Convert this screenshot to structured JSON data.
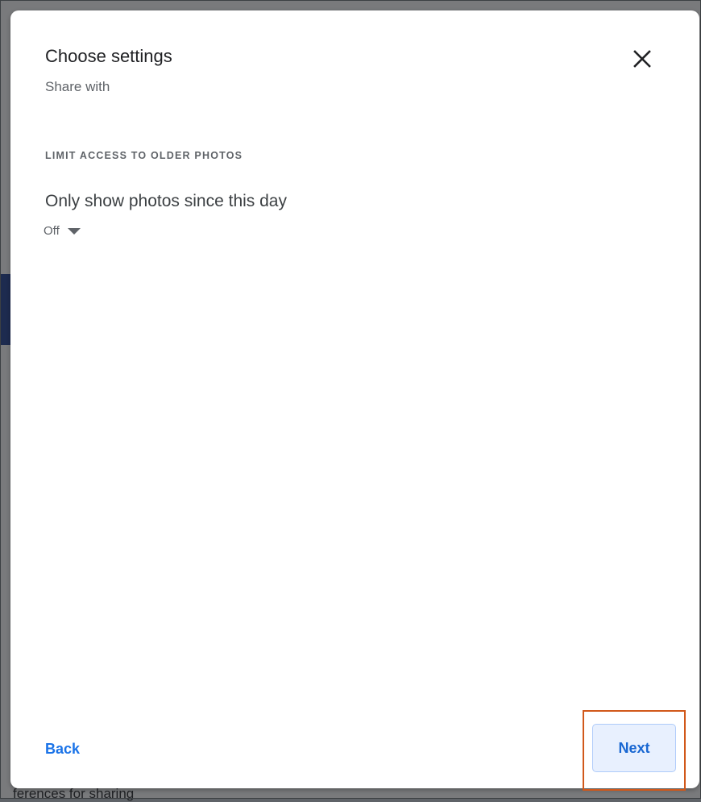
{
  "background": {
    "partial_text": "ferences for sharing"
  },
  "dialog": {
    "title": "Choose settings",
    "subtitle": "Share with",
    "close_icon": "close-icon",
    "section": {
      "label": "LIMIT ACCESS TO OLDER PHOTOS",
      "option_title": "Only show photos since this day",
      "dropdown": {
        "selected": "Off",
        "icon": "caret-down-icon"
      }
    },
    "footer": {
      "back_label": "Back",
      "next_label": "Next"
    }
  },
  "colors": {
    "accent": "#1a73e8",
    "next_button_bg": "#e8f0fe",
    "highlight_border": "#d1581a"
  }
}
